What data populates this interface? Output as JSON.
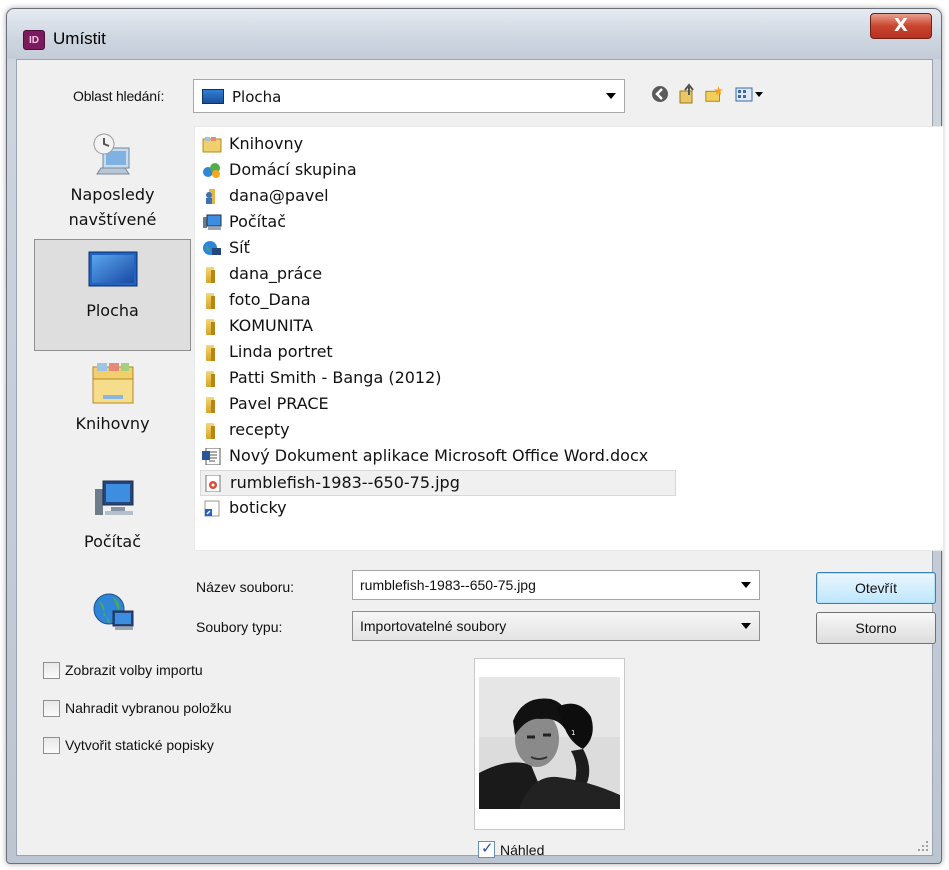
{
  "window": {
    "title": "Umístit",
    "app_icon_text": "ID",
    "close_glyph": "X"
  },
  "lookin": {
    "label": "Oblast hledání:",
    "value": "Plocha",
    "icon": "desktop-icon"
  },
  "toolbar": {
    "icons": [
      "back-icon",
      "up-folder-icon",
      "new-folder-icon",
      "view-menu-icon"
    ]
  },
  "places": [
    {
      "label": "Naposledy navštívené",
      "icon": "recent-places-icon",
      "selected": false
    },
    {
      "label": "Plocha",
      "icon": "desktop-icon",
      "selected": true
    },
    {
      "label": "Knihovny",
      "icon": "libraries-icon",
      "selected": false
    },
    {
      "label": "Počítač",
      "icon": "computer-icon",
      "selected": false
    },
    {
      "label": "",
      "icon": "network-icon",
      "selected": false
    }
  ],
  "files": [
    {
      "name": "Knihovny",
      "icon": "libraries-icon"
    },
    {
      "name": "Domácí skupina",
      "icon": "homegroup-icon"
    },
    {
      "name": "dana@pavel",
      "icon": "user-folder-icon"
    },
    {
      "name": "Počítač",
      "icon": "computer-icon"
    },
    {
      "name": "Síť",
      "icon": "network-icon"
    },
    {
      "name": "dana_práce",
      "icon": "folder-icon"
    },
    {
      "name": "foto_Dana",
      "icon": "folder-icon"
    },
    {
      "name": "KOMUNITA",
      "icon": "folder-icon"
    },
    {
      "name": "Linda portret",
      "icon": "folder-icon"
    },
    {
      "name": "Patti Smith - Banga (2012)",
      "icon": "folder-icon"
    },
    {
      "name": "Pavel PRACE",
      "icon": "folder-icon"
    },
    {
      "name": "recepty",
      "icon": "folder-icon"
    },
    {
      "name": "Nový Dokument aplikace Microsoft Office Word.docx",
      "icon": "word-document-icon"
    },
    {
      "name": "rumblefish-1983--650-75.jpg",
      "icon": "jpg-file-icon",
      "selected": true
    },
    {
      "name": "boticky",
      "icon": "shortcut-icon"
    }
  ],
  "filename": {
    "label": "Název souboru:",
    "value": "rumblefish-1983--650-75.jpg"
  },
  "filetype": {
    "label": "Soubory typu:",
    "value": "Importovatelné soubory"
  },
  "buttons": {
    "open": "Otevřít",
    "cancel": "Storno"
  },
  "options": [
    {
      "label": "Zobrazit volby importu",
      "checked": false
    },
    {
      "label": "Nahradit vybranou položku",
      "checked": false
    },
    {
      "label": "Vytvořit statické popisky",
      "checked": false
    }
  ],
  "preview": {
    "label": "Náhled",
    "checked": true,
    "check_glyph": "✓"
  }
}
